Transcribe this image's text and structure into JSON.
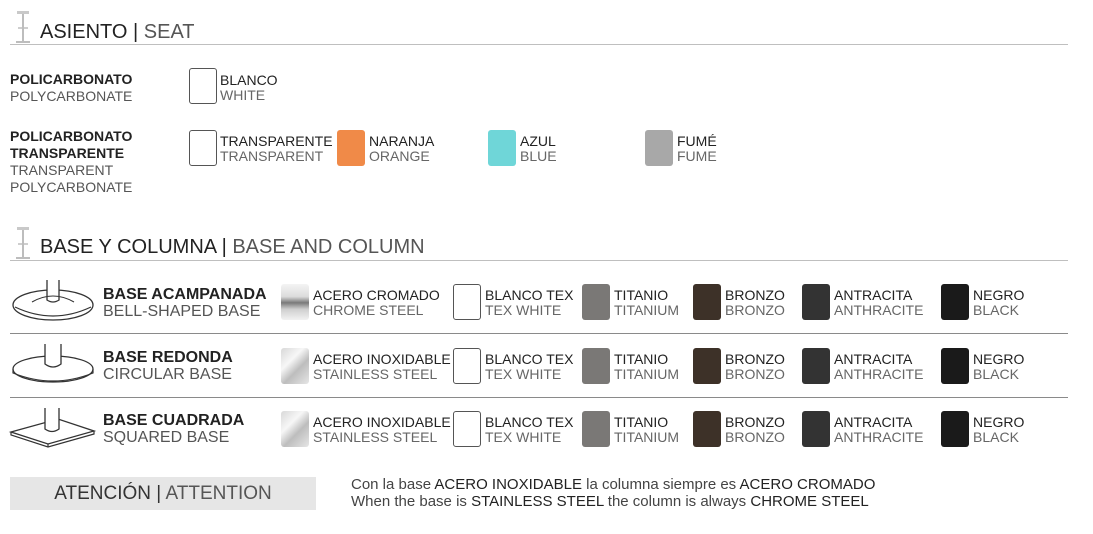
{
  "seat": {
    "title_es": "ASIENTO",
    "separator": "|",
    "title_en": "SEAT",
    "materials": [
      {
        "name_es": "POLICARBONATO",
        "name_en": "POLYCARBONATE",
        "colors": [
          {
            "es": "BLANCO",
            "en": "WHITE",
            "swatch": "#ffffff"
          }
        ]
      },
      {
        "name_es_1": "POLICARBONATO",
        "name_es_2": "TRANSPARENTE",
        "name_en_1": "TRANSPARENT",
        "name_en_2": "POLYCARBONATE",
        "colors": [
          {
            "es": "TRANSPARENTE",
            "en": "TRANSPARENT",
            "swatch": "#ffffff"
          },
          {
            "es": "NARANJA",
            "en": "ORANGE",
            "swatch": "#f08a48"
          },
          {
            "es": "AZUL",
            "en": "BLUE",
            "swatch": "#6fd6d8"
          },
          {
            "es": "FUMÉ",
            "en": "FUME",
            "swatch": "#a8a8a8"
          }
        ]
      }
    ]
  },
  "base": {
    "title_es": "BASE Y COLUMNA",
    "separator": "|",
    "title_en": "BASE AND COLUMN",
    "rows": [
      {
        "name_es": "BASE ACAMPANADA",
        "name_en": "BELL-SHAPED BASE",
        "finishes": [
          {
            "es": "ACERO CROMADO",
            "en": "CHROME STEEL"
          },
          {
            "es": "BLANCO TEX",
            "en": "TEX WHITE"
          },
          {
            "es": "TITANIO",
            "en": "TITANIUM"
          },
          {
            "es": "BRONZO",
            "en": "BRONZO"
          },
          {
            "es": "ANTRACITA",
            "en": "ANTHRACITE"
          },
          {
            "es": "NEGRO",
            "en": "BLACK"
          }
        ]
      },
      {
        "name_es": "BASE REDONDA",
        "name_en": "CIRCULAR BASE",
        "finishes": [
          {
            "es": "ACERO INOXIDABLE",
            "en": "STAINLESS STEEL"
          },
          {
            "es": "BLANCO TEX",
            "en": "TEX WHITE"
          },
          {
            "es": "TITANIO",
            "en": "TITANIUM"
          },
          {
            "es": "BRONZO",
            "en": "BRONZO"
          },
          {
            "es": "ANTRACITA",
            "en": "ANTHRACITE"
          },
          {
            "es": "NEGRO",
            "en": "BLACK"
          }
        ]
      },
      {
        "name_es": "BASE CUADRADA",
        "name_en": "SQUARED BASE",
        "finishes": [
          {
            "es": "ACERO INOXIDABLE",
            "en": "STAINLESS STEEL"
          },
          {
            "es": "BLANCO TEX",
            "en": "TEX WHITE"
          },
          {
            "es": "TITANIO",
            "en": "TITANIUM"
          },
          {
            "es": "BRONZO",
            "en": "BRONZO"
          },
          {
            "es": "ANTRACITA",
            "en": "ANTHRACITE"
          },
          {
            "es": "NEGRO",
            "en": "BLACK"
          }
        ]
      }
    ],
    "swatch_colors": {
      "tex_white": "#ffffff",
      "titanium": "#7a7876",
      "bronze": "#3d3128",
      "anthracite": "#333333",
      "black": "#1a1a1a"
    }
  },
  "attention": {
    "label_es": "ATENCIÓN",
    "separator": "|",
    "label_en": "ATTENTION",
    "line_es": {
      "p1": "Con la base ",
      "b1": "ACERO INOXIDABLE",
      "p2": " la columna siempre es ",
      "b2": "ACERO CROMADO"
    },
    "line_en": {
      "p1": "When the base is ",
      "b1": "STAINLESS STEEL",
      "p2": " the column is always ",
      "b2": "CHROME STEEL"
    }
  }
}
